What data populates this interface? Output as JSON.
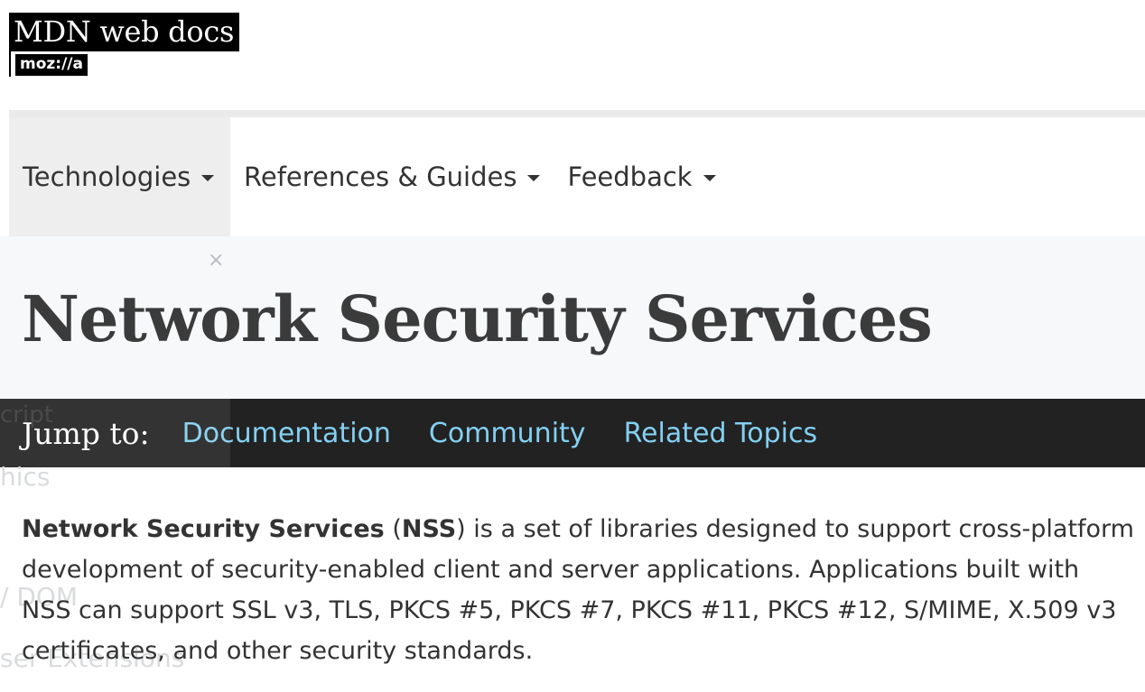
{
  "logo": {
    "line1": "MDN web docs",
    "line2": "moz://a"
  },
  "nav": {
    "items": [
      {
        "label": "Technologies"
      },
      {
        "label": "References & Guides"
      },
      {
        "label": "Feedback"
      }
    ]
  },
  "sidebar_ghost": {
    "close": "×",
    "items": [
      "cript",
      "hics",
      "/ DOM",
      "ser Extensions"
    ]
  },
  "page": {
    "title": "Network Security Services"
  },
  "jump": {
    "label": "Jump to:",
    "links": [
      "Documentation",
      "Community",
      "Related Topics"
    ]
  },
  "intro": {
    "term": "Network Security Services",
    "open_paren": " (",
    "abbr": "NSS",
    "text": ") is a set of libraries designed to support cross-platform development of security-enabled client and server applications. Applications built with NSS can support SSL v3, TLS, PKCS #5, PKCS #7, PKCS #11, PKCS #12, S/MIME, X.509 v3 certificates, and other security standards."
  }
}
